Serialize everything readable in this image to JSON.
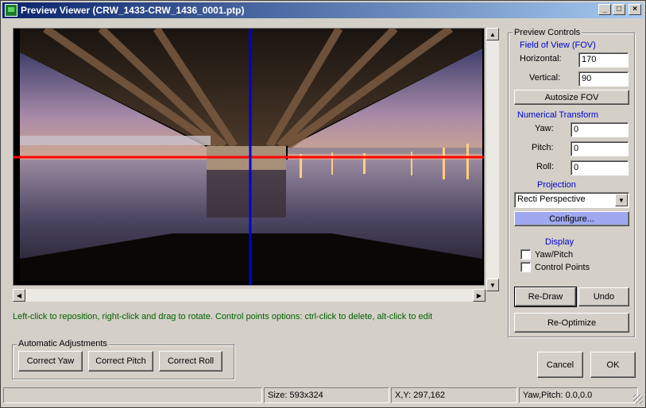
{
  "window": {
    "title": "Preview Viewer (CRW_1433-CRW_1436_0001.ptp)"
  },
  "titlebar_buttons": {
    "minimize": "_",
    "maximize": "□",
    "close": "×"
  },
  "preview_controls": {
    "legend": "Preview Controls",
    "fov_header": "Field of View (FOV)",
    "horizontal_label": "Horizontal:",
    "horizontal_value": "170",
    "vertical_label": "Vertical:",
    "vertical_value": "90",
    "autosize_label": "Autosize FOV",
    "transform_header": "Numerical Transform",
    "yaw_label": "Yaw:",
    "yaw_value": "0",
    "pitch_label": "Pitch:",
    "pitch_value": "0",
    "roll_label": "Roll:",
    "roll_value": "0",
    "projection_header": "Projection",
    "projection_value": "Recti Perspective",
    "configure_label": "Configure...",
    "display_header": "Display",
    "yawpitch_label": "Yaw/Pitch",
    "controlpoints_label": "Control Points"
  },
  "actions": {
    "redraw": "Re-Draw",
    "undo": "Undo",
    "reoptimize": "Re-Optimize",
    "cancel": "Cancel",
    "ok": "OK"
  },
  "hint": "Left-click to reposition, right-click and drag to rotate. Control points options: ctrl-click to delete, alt-click to edit",
  "auto_adjust": {
    "legend": "Automatic Adjustments",
    "correct_yaw": "Correct Yaw",
    "correct_pitch": "Correct Pitch",
    "correct_roll": "Correct Roll"
  },
  "status": {
    "pane1": "",
    "size": "Size: 593x324",
    "xy": "X,Y: 297,162",
    "yawpitch": "Yaw,Pitch: 0.0,0.0"
  },
  "colors": {
    "guide_horizontal": "#ff0000",
    "guide_vertical": "#0000d0",
    "configure_bg": "#a0a8f0"
  }
}
